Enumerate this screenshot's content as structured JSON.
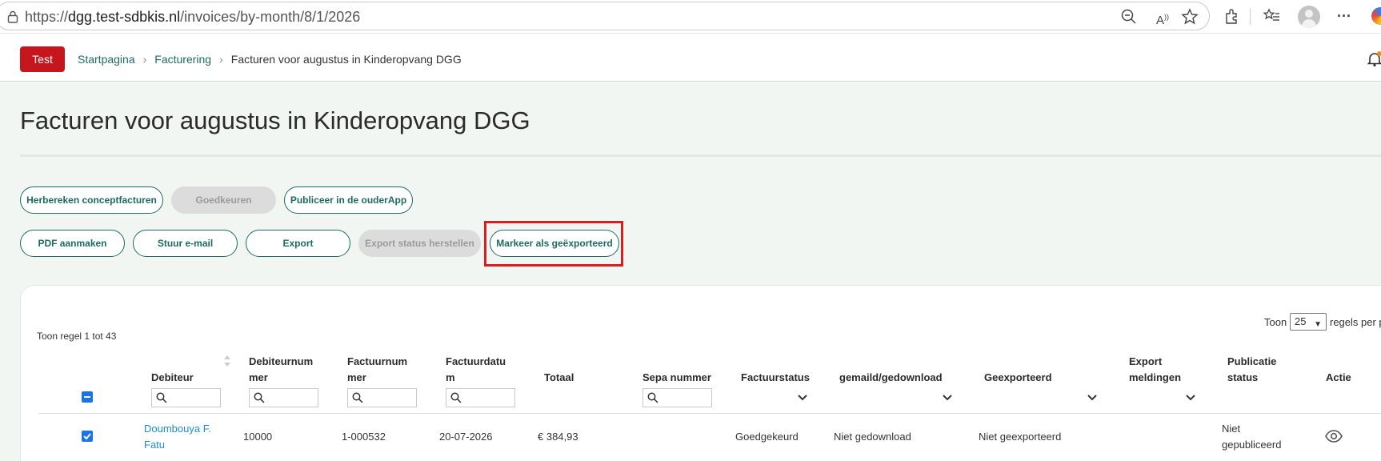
{
  "browser": {
    "url_prefix": "https://",
    "url_domain": "dgg.test-sdbkis.nl",
    "url_path": "/invoices/by-month/8/1/2026"
  },
  "header": {
    "env_badge": "Test",
    "breadcrumbs": [
      "Startpagina",
      "Facturering",
      "Facturen voor augustus in Kinderopvang DGG"
    ],
    "accent_color": "#1d6b62",
    "badge_color": "#c4161c"
  },
  "page": {
    "title": "Facturen voor augustus in Kinderopvang DGG"
  },
  "actions": {
    "row1": [
      {
        "label": "Herbereken conceptfacturen",
        "disabled": false
      },
      {
        "label": "Goedkeuren",
        "disabled": true
      },
      {
        "label": "Publiceer in de ouderApp",
        "disabled": false
      }
    ],
    "row2": [
      {
        "label": "PDF aanmaken",
        "disabled": false
      },
      {
        "label": "Stuur e-mail",
        "disabled": false
      },
      {
        "label": "Export",
        "disabled": false
      },
      {
        "label": "Export status herstellen",
        "disabled": true
      },
      {
        "label": "Markeer als geëxporteerd",
        "disabled": false,
        "highlighted": true
      }
    ]
  },
  "table": {
    "info": "Toon regel 1 tot 43",
    "length": {
      "prefix": "Toon",
      "value": "25",
      "suffix": "regels per p"
    },
    "columns": [
      {
        "l1": "",
        "l2": "Debiteur"
      },
      {
        "l1": "Debiteurnum",
        "l2": "mer"
      },
      {
        "l1": "Factuurnum",
        "l2": "mer"
      },
      {
        "l1": "Factuurdatu",
        "l2": "m"
      },
      {
        "l1": "",
        "l2": "Totaal"
      },
      {
        "l1": "",
        "l2": "Sepa nummer"
      },
      {
        "l1": "",
        "l2": "Factuurstatus"
      },
      {
        "l1": "",
        "l2": "gemaild/gedownload"
      },
      {
        "l1": "",
        "l2": "Geexporteerd"
      },
      {
        "l1": "Export",
        "l2": "meldingen"
      },
      {
        "l1": "Publicatie",
        "l2": "status"
      },
      {
        "l1": "",
        "l2": "Actie"
      }
    ],
    "rows": [
      {
        "checked": true,
        "debiteur_l1": "Doumbouya F.",
        "debiteur_l2": "Fatu",
        "debiteurnummer": "10000",
        "factuurnummer": "1-000532",
        "factuurdatum": "20-07-2026",
        "totaal": "€ 384,93",
        "sepa": "",
        "factuurstatus": "Goedgekeurd",
        "gemaild": "Niet gedownload",
        "geexporteerd": "Niet geexporteerd",
        "export_meldingen": "",
        "publicatie_l1": "Niet",
        "publicatie_l2": "gepubliceerd",
        "actie_icon": "eye-icon"
      }
    ]
  }
}
